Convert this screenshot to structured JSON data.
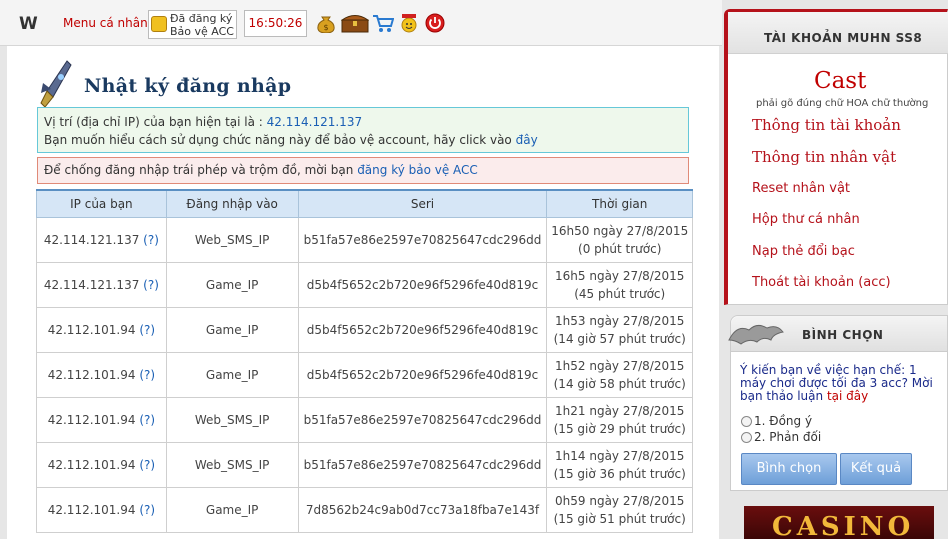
{
  "topbar": {
    "logo": "W",
    "menu_label": "Menu cá nhân",
    "protect_line1": "Đã đăng ký",
    "protect_line2": "Bảo vệ ACC",
    "clock": "16:50:26",
    "icons": [
      "money-bag-icon",
      "treasure-chest-icon",
      "shopping-cart-icon",
      "gift-smiley-icon",
      "power-icon"
    ]
  },
  "page": {
    "title": "Nhật ký đăng nhập",
    "info_line1_prefix": "Vị trí (địa chỉ IP) của bạn hiện tại là :",
    "current_ip": "42.114.121.137",
    "info_line2_prefix": "Bạn muốn hiểu cách sử dụng chức năng này để bảo vệ account, hãy click vào",
    "info_link": "đây",
    "warn_prefix": "Để chống đăng nhập trái phép và trộm đồ, mời bạn",
    "warn_link": "đăng ký bảo vệ ACC"
  },
  "table": {
    "headers": [
      "IP của bạn",
      "Đăng nhập vào",
      "Seri",
      "Thời gian"
    ],
    "rows": [
      {
        "ip": "42.114.121.137",
        "q": "(?)",
        "login": "Web_SMS_IP",
        "seri": "b51fa57e86e2597e70825647cdc296dd",
        "time": "16h50 ngày 27/8/2015",
        "ago": "(0 phút trước)"
      },
      {
        "ip": "42.114.121.137",
        "q": "(?)",
        "login": "Game_IP",
        "seri": "d5b4f5652c2b720e96f5296fe40d819c",
        "time": "16h5 ngày 27/8/2015",
        "ago": "(45 phút trước)"
      },
      {
        "ip": "42.112.101.94",
        "q": "(?)",
        "login": "Game_IP",
        "seri": "d5b4f5652c2b720e96f5296fe40d819c",
        "time": "1h53 ngày 27/8/2015",
        "ago": "(14 giờ 57 phút trước)"
      },
      {
        "ip": "42.112.101.94",
        "q": "(?)",
        "login": "Game_IP",
        "seri": "d5b4f5652c2b720e96f5296fe40d819c",
        "time": "1h52 ngày 27/8/2015",
        "ago": "(14 giờ 58 phút trước)"
      },
      {
        "ip": "42.112.101.94",
        "q": "(?)",
        "login": "Web_SMS_IP",
        "seri": "b51fa57e86e2597e70825647cdc296dd",
        "time": "1h21 ngày 27/8/2015",
        "ago": "(15 giờ 29 phút trước)"
      },
      {
        "ip": "42.112.101.94",
        "q": "(?)",
        "login": "Web_SMS_IP",
        "seri": "b51fa57e86e2597e70825647cdc296dd",
        "time": "1h14 ngày 27/8/2015",
        "ago": "(15 giờ 36 phút trước)"
      },
      {
        "ip": "42.112.101.94",
        "q": "(?)",
        "login": "Game_IP",
        "seri": "7d8562b24c9ab0d7cc73a18fba7e143f",
        "time": "0h59 ngày 27/8/2015",
        "ago": "(15 giờ 51 phút trước)"
      }
    ]
  },
  "account": {
    "header": "TÀI KHOẢN MUHN SS8",
    "captcha": "Cast",
    "captcha_note": "phải gõ đúng chữ HOA chữ thường",
    "links": [
      "Thông tin tài khoản",
      "Thông tin nhân vật",
      "Reset nhân vật",
      "Hộp thư cá nhân",
      "Nạp thẻ đổi bạc",
      "Thoát tài khoản (acc)"
    ]
  },
  "poll": {
    "header": "BÌNH CHỌN",
    "question": "Ý kiến bạn về việc hạn chế: 1 máy chơi được tối đa 3 acc? Mời bạn thảo luận",
    "question_link": "tại đây",
    "options": [
      "1. Đồng ý",
      "2. Phản đối"
    ],
    "vote_button": "Bình chọn",
    "result_button": "Kết quả"
  },
  "banner": {
    "text": "CASINO"
  },
  "colors": {
    "accent_red": "#b5121b",
    "link_blue": "#1a5fb4",
    "title_navy": "#1a3a60"
  }
}
